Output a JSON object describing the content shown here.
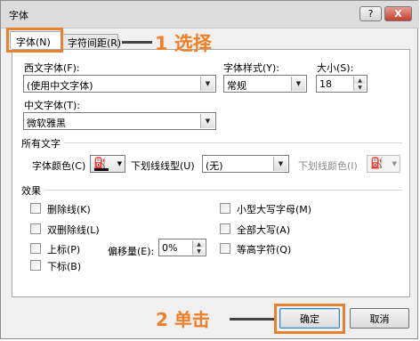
{
  "window": {
    "title": "字体",
    "help_label": "?",
    "close_label": "X"
  },
  "tabs": [
    {
      "label": "字体(N)"
    },
    {
      "label": "字符间距(R)"
    }
  ],
  "annotations": {
    "step1": "1 选择",
    "step2": "2 单击"
  },
  "western_font": {
    "label": "西文字体(F):",
    "value": "(使用中文字体)"
  },
  "font_style": {
    "label": "字体样式(Y):",
    "value": "常规"
  },
  "size": {
    "label": "大小(S):",
    "value": "18"
  },
  "chinese_font": {
    "label": "中文字体(T):",
    "value": "微软雅黑"
  },
  "all_text": {
    "heading": "所有文字",
    "font_color_label": "字体颜色(C)",
    "underline_type_label": "下划线线型(U)",
    "underline_type_value": "(无)",
    "underline_color_label": "下划线颜色(I)"
  },
  "effects": {
    "heading": "效果",
    "strikethrough": "删除线(K)",
    "double_strikethrough": "双删除线(L)",
    "superscript": "上标(P)",
    "subscript": "下标(B)",
    "offset_label": "偏移量(E):",
    "offset_value": "0%",
    "small_caps": "小型大写字母(M)",
    "all_caps": "全部大写(A)",
    "equalize_height": "等高字符(Q)"
  },
  "buttons": {
    "ok": "确定",
    "cancel": "取消"
  },
  "colors": {
    "accent_orange": "#e8822e",
    "ok_border": "#3c7fb1"
  }
}
